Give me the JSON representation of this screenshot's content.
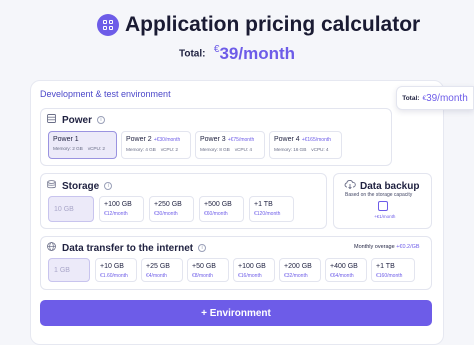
{
  "header": {
    "title": "Application pricing calculator",
    "total_label": "Total:",
    "currency": "€",
    "total_amount": "39/month"
  },
  "sticky_total": {
    "label": "Total:",
    "currency": "€",
    "amount": "39/month"
  },
  "environment": {
    "title": "Development & test environment"
  },
  "power": {
    "title": "Power",
    "options": [
      {
        "name": "Power 1",
        "price": "",
        "memory": "Memory: 2 GB",
        "vcpu": "vCPU: 2",
        "selected": true
      },
      {
        "name": "Power 2",
        "price": "+€30/month",
        "memory": "Memory: 4 GB",
        "vcpu": "vCPU: 2",
        "selected": false
      },
      {
        "name": "Power 3",
        "price": "+€75/month",
        "memory": "Memory: 8 GB",
        "vcpu": "vCPU: 4",
        "selected": false
      },
      {
        "name": "Power 4",
        "price": "+€165/month",
        "memory": "Memory: 16 GB",
        "vcpu": "vCPU: 4",
        "selected": false
      }
    ]
  },
  "storage": {
    "title": "Storage",
    "options": [
      {
        "name": "10 GB",
        "price": "",
        "selected": true
      },
      {
        "name": "+100 GB",
        "price": "€12/month"
      },
      {
        "name": "+250 GB",
        "price": "€30/month"
      },
      {
        "name": "+500 GB",
        "price": "€60/month"
      },
      {
        "name": "+1 TB",
        "price": "€120/month"
      }
    ]
  },
  "backup": {
    "title": "Data backup",
    "subtitle": "Based on the storage capacity",
    "price": "+€1/month"
  },
  "transfer": {
    "title": "Data transfer to the internet",
    "overage_label": "Monthly overage",
    "overage_value": "+€0.2/GB",
    "options": [
      {
        "name": "1 GB",
        "price": "",
        "selected": true
      },
      {
        "name": "+10 GB",
        "price": "€1.60/month"
      },
      {
        "name": "+25 GB",
        "price": "€4/month"
      },
      {
        "name": "+50 GB",
        "price": "€8/month"
      },
      {
        "name": "+100 GB",
        "price": "€16/month"
      },
      {
        "name": "+200 GB",
        "price": "€32/month"
      },
      {
        "name": "+400 GB",
        "price": "€64/month"
      },
      {
        "name": "+1 TB",
        "price": "€160/month"
      }
    ]
  },
  "actions": {
    "add_environment": "+ Environment"
  },
  "colors": {
    "accent": "#6d5ce8",
    "selected_bg": "#eceaf9",
    "background": "#f5f6fa"
  },
  "icons": [
    "app-logo-icon",
    "power-icon",
    "info-icon",
    "storage-icon",
    "cloud-download-icon",
    "globe-icon"
  ]
}
